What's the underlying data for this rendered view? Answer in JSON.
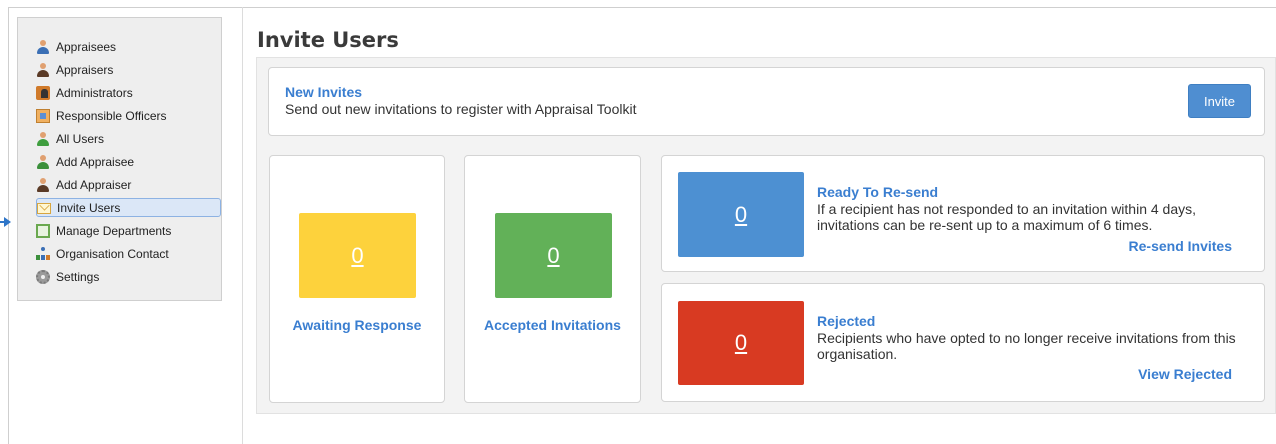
{
  "page": {
    "title": "Invite Users"
  },
  "sidebar": {
    "items": [
      {
        "label": "Appraisees",
        "icon": "appraisees-icon"
      },
      {
        "label": "Appraisers",
        "icon": "appraisers-icon"
      },
      {
        "label": "Administrators",
        "icon": "administrators-icon"
      },
      {
        "label": "Responsible Officers",
        "icon": "responsible-officers-icon"
      },
      {
        "label": "All Users",
        "icon": "all-users-icon"
      },
      {
        "label": "Add Appraisee",
        "icon": "add-appraisee-icon"
      },
      {
        "label": "Add Appraiser",
        "icon": "add-appraiser-icon"
      },
      {
        "label": "Invite Users",
        "icon": "envelope-icon",
        "active": true
      },
      {
        "label": "Manage Departments",
        "icon": "departments-icon"
      },
      {
        "label": "Organisation Contact",
        "icon": "organisation-icon"
      },
      {
        "label": "Settings",
        "icon": "gear-icon"
      }
    ]
  },
  "new_invites": {
    "title": "New Invites",
    "description": "Send out new invitations to register with Appraisal Toolkit",
    "button_label": "Invite"
  },
  "stats": {
    "awaiting": {
      "count": "0",
      "label": "Awaiting Response",
      "color": "#fdd23c"
    },
    "accepted": {
      "count": "0",
      "label": "Accepted Invitations",
      "color": "#62b158"
    }
  },
  "resend": {
    "count": "0",
    "title": "Ready To Re-send",
    "description": "If a recipient has not responded to an invitation within 4 days, invitations can be re-sent up to a maximum of 6 times.",
    "link": "Re-send Invites",
    "color": "#4d90d2"
  },
  "rejected": {
    "count": "0",
    "title": "Rejected",
    "description": "Recipients who have opted to no longer receive invitations from this organisation.",
    "link": "View Rejected",
    "color": "#d83a22"
  },
  "colors": {
    "accent": "#3a7ed0",
    "button": "#4f8ed1"
  }
}
